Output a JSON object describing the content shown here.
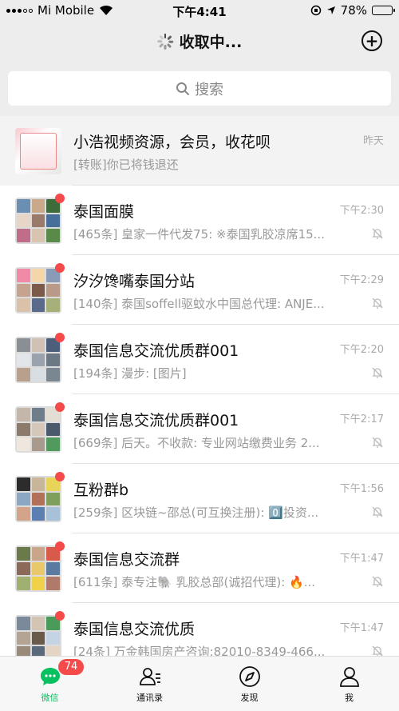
{
  "status_bar": {
    "carrier": "Mi Mobile",
    "time": "下午4:41",
    "battery": "78%",
    "battery_level": 0.78
  },
  "nav": {
    "title": "收取中..."
  },
  "search": {
    "placeholder": "搜索"
  },
  "chats": [
    {
      "name": "小浩视频资源，会员，收花呗",
      "preview": "[转账]你已将钱退还",
      "time": "昨天",
      "unread_dot": false,
      "muted": false,
      "pinned": true
    },
    {
      "name": "泰国面膜",
      "preview": "[465条] 皇家一件代发75: ※泰国乳胶凉席15...",
      "time": "下午2:30",
      "unread_dot": true,
      "muted": true
    },
    {
      "name": "汐汐馋嘴泰国分站",
      "preview": "[140条] 泰国soffell驱蚊水中国总代理: ANJE...",
      "time": "下午2:29",
      "unread_dot": true,
      "muted": true
    },
    {
      "name": "泰国信息交流优质群001",
      "preview": "[194条] 漫步: [图片]",
      "time": "下午2:20",
      "unread_dot": true,
      "muted": true
    },
    {
      "name": "泰国信息交流优质群001",
      "preview": "[669条] 后天。不收款: 专业网站缴费业务 2...",
      "time": "下午2:17",
      "unread_dot": true,
      "muted": true
    },
    {
      "name": "互粉群b",
      "preview": "[259条] 区块链~邵总(可互换注册): 0️⃣投资...",
      "time": "下午1:56",
      "unread_dot": true,
      "muted": true
    },
    {
      "name": "泰国信息交流群",
      "preview": "[611条] 泰专注🐘 乳胶总部(诚招代理): 🔥...",
      "time": "下午1:47",
      "unread_dot": true,
      "muted": true
    },
    {
      "name": "泰国信息交流优质",
      "preview": "[24条] 万金韩国房产咨询:82010-8349-466...",
      "time": "下午1:47",
      "unread_dot": true,
      "muted": true
    }
  ],
  "tabs": [
    {
      "label": "微信",
      "badge": "74",
      "active": true,
      "icon": "chat-bubble-icon"
    },
    {
      "label": "通讯录",
      "active": false,
      "icon": "contacts-icon"
    },
    {
      "label": "发现",
      "active": false,
      "icon": "compass-icon"
    },
    {
      "label": "我",
      "active": false,
      "icon": "person-icon"
    }
  ],
  "colors": {
    "accent": "#07c160",
    "badge": "#f44a4a",
    "background": "#ededed"
  }
}
